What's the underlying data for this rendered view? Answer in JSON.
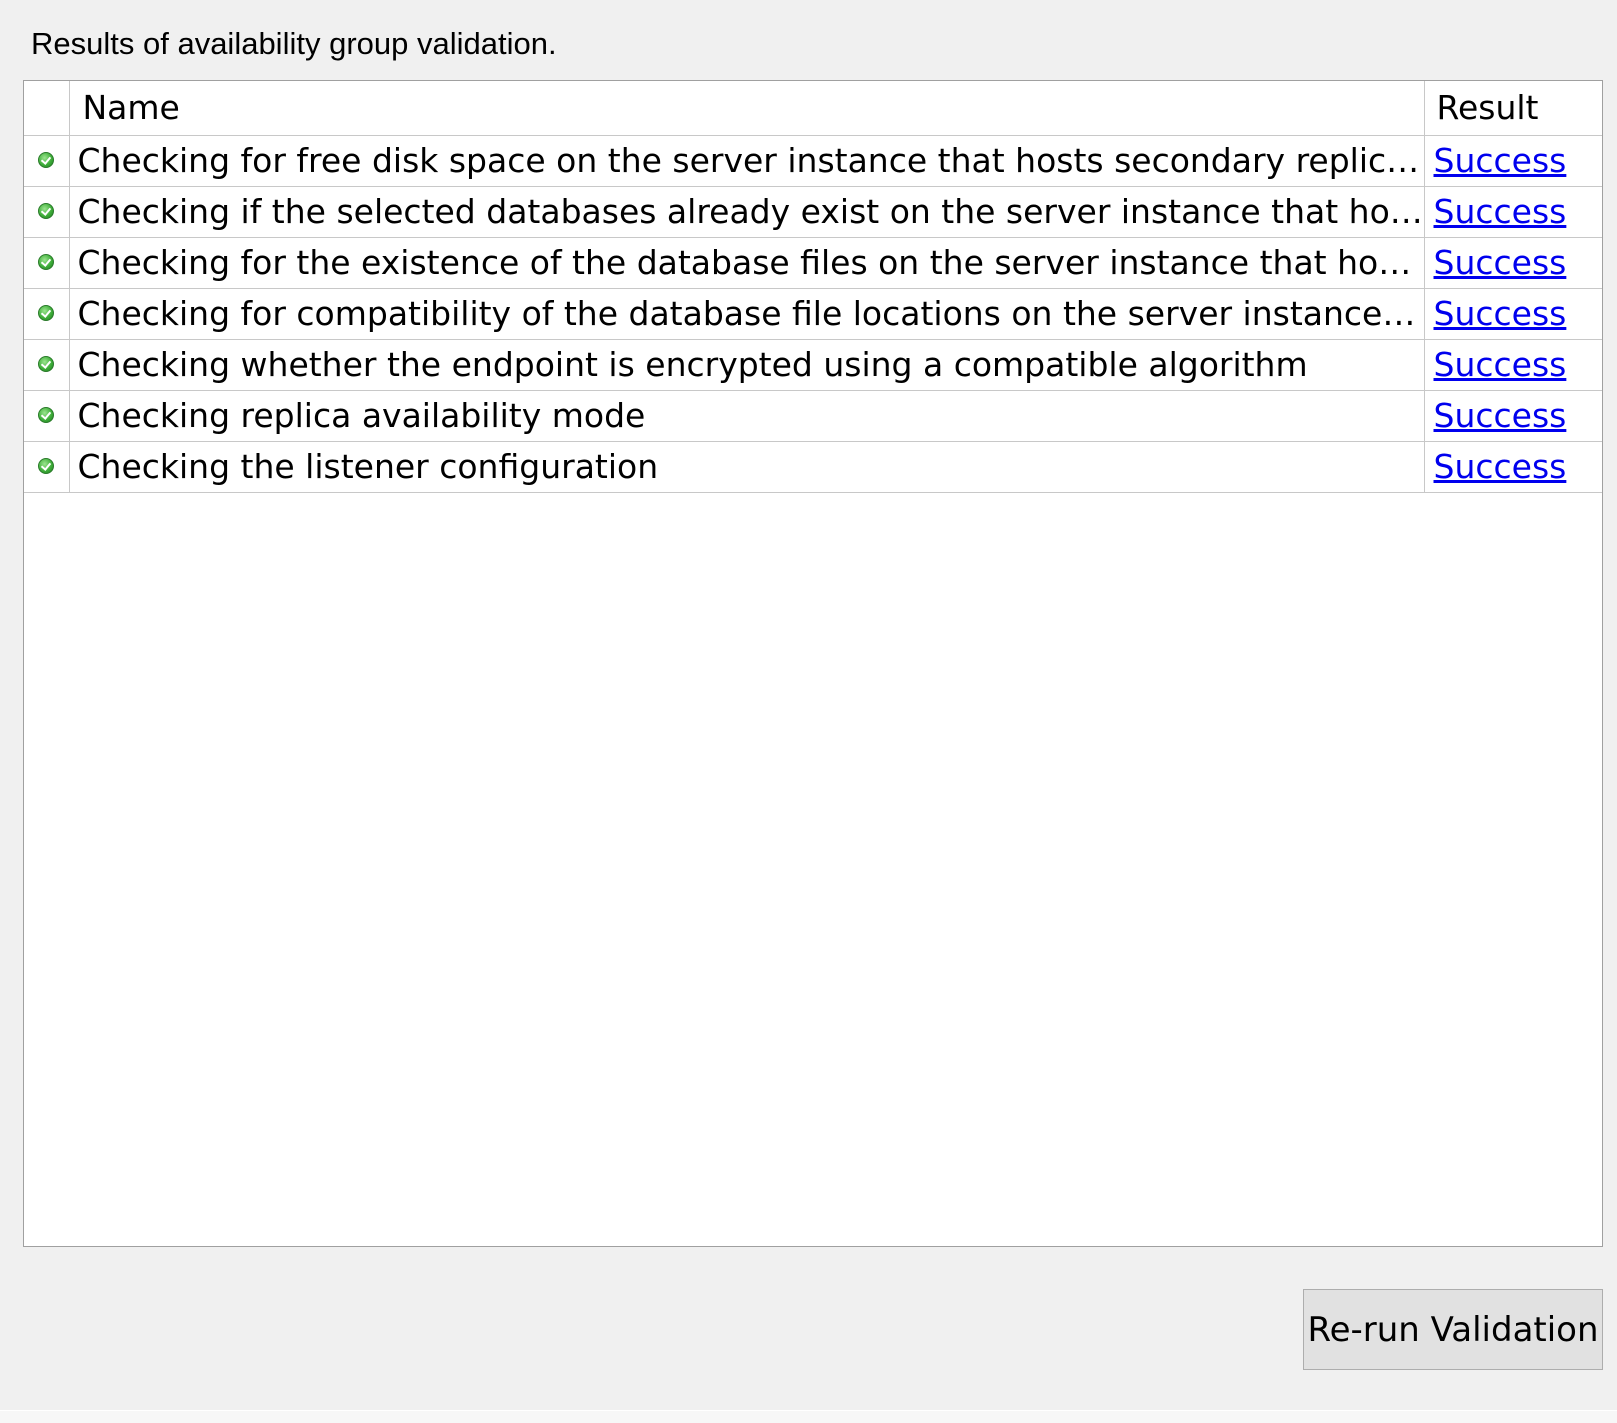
{
  "heading": "Results of availability group validation.",
  "table": {
    "columns": {
      "name": "Name",
      "result": "Result"
    },
    "rows": [
      {
        "icon": "success-check-icon",
        "name": "Checking for free disk space on the server instance that hosts secondary replica az...",
        "result": "Success"
      },
      {
        "icon": "success-check-icon",
        "name": "Checking if the selected databases already exist on the server instance that hosts s...",
        "result": "Success"
      },
      {
        "icon": "success-check-icon",
        "name": "Checking for the existence of the database files on the server instance that hosts s...",
        "result": "Success"
      },
      {
        "icon": "success-check-icon",
        "name": "Checking for compatibility of the database file locations on the server instance tha...",
        "result": "Success"
      },
      {
        "icon": "success-check-icon",
        "name": "Checking whether the endpoint is encrypted using a compatible algorithm",
        "result": "Success"
      },
      {
        "icon": "success-check-icon",
        "name": "Checking replica availability mode",
        "result": "Success"
      },
      {
        "icon": "success-check-icon",
        "name": "Checking the listener configuration",
        "result": "Success"
      }
    ]
  },
  "buttons": {
    "rerun": "Re-run Validation"
  },
  "colors": {
    "background": "#f0f0f0",
    "link": "#0000ee",
    "success": "#3fae3a"
  }
}
